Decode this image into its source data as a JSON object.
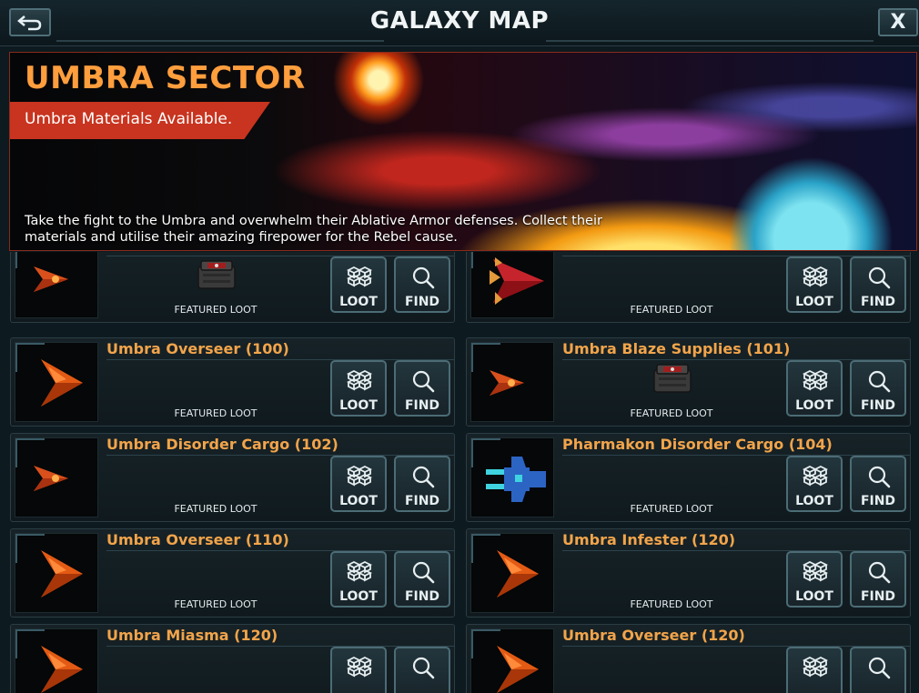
{
  "header": {
    "title": "GALAXY MAP",
    "close_label": "X",
    "back_icon": "back-arrow-icon"
  },
  "banner": {
    "title": "UMBRA SECTOR",
    "ribbon": "Umbra Materials Available.",
    "description": "Take the fight to the Umbra and overwhelm their Ablative Armor defenses. Collect their materials and utilise their amazing firepower for the Rebel cause."
  },
  "colors": {
    "accent": "#f2a44a",
    "ribbon": "#c8341f",
    "title": "#ff9e3d"
  },
  "cards": [
    {
      "name": "",
      "loot_label": "FEATURED LOOT",
      "loot_btn": "LOOT",
      "find_btn": "FIND",
      "ship": "umbra-fighter",
      "has_crate": true
    },
    {
      "name": "",
      "loot_label": "FEATURED LOOT",
      "loot_btn": "LOOT",
      "find_btn": "FIND",
      "ship": "umbra-red",
      "has_crate": false
    },
    {
      "name": "Umbra Overseer (100)",
      "loot_label": "FEATURED LOOT",
      "loot_btn": "LOOT",
      "find_btn": "FIND",
      "ship": "umbra-chevron",
      "has_crate": false
    },
    {
      "name": "Umbra Blaze Supplies (101)",
      "loot_label": "FEATURED LOOT",
      "loot_btn": "LOOT",
      "find_btn": "FIND",
      "ship": "umbra-fighter",
      "has_crate": true
    },
    {
      "name": "Umbra Disorder Cargo (102)",
      "loot_label": "FEATURED LOOT",
      "loot_btn": "LOOT",
      "find_btn": "FIND",
      "ship": "umbra-fighter",
      "has_crate": false
    },
    {
      "name": "Pharmakon Disorder Cargo (104)",
      "loot_label": "FEATURED LOOT",
      "loot_btn": "LOOT",
      "find_btn": "FIND",
      "ship": "pharmakon",
      "has_crate": false
    },
    {
      "name": "Umbra Overseer (110)",
      "loot_label": "FEATURED LOOT",
      "loot_btn": "LOOT",
      "find_btn": "FIND",
      "ship": "umbra-chevron",
      "has_crate": false
    },
    {
      "name": "Umbra Infester (120)",
      "loot_label": "FEATURED LOOT",
      "loot_btn": "LOOT",
      "find_btn": "FIND",
      "ship": "umbra-chevron",
      "has_crate": false
    },
    {
      "name": "Umbra Miasma (120)",
      "loot_label": "",
      "loot_btn": "",
      "find_btn": "",
      "ship": "umbra-chevron",
      "has_crate": false
    },
    {
      "name": "Umbra Overseer (120)",
      "loot_label": "",
      "loot_btn": "",
      "find_btn": "",
      "ship": "umbra-chevron",
      "has_crate": false
    }
  ]
}
